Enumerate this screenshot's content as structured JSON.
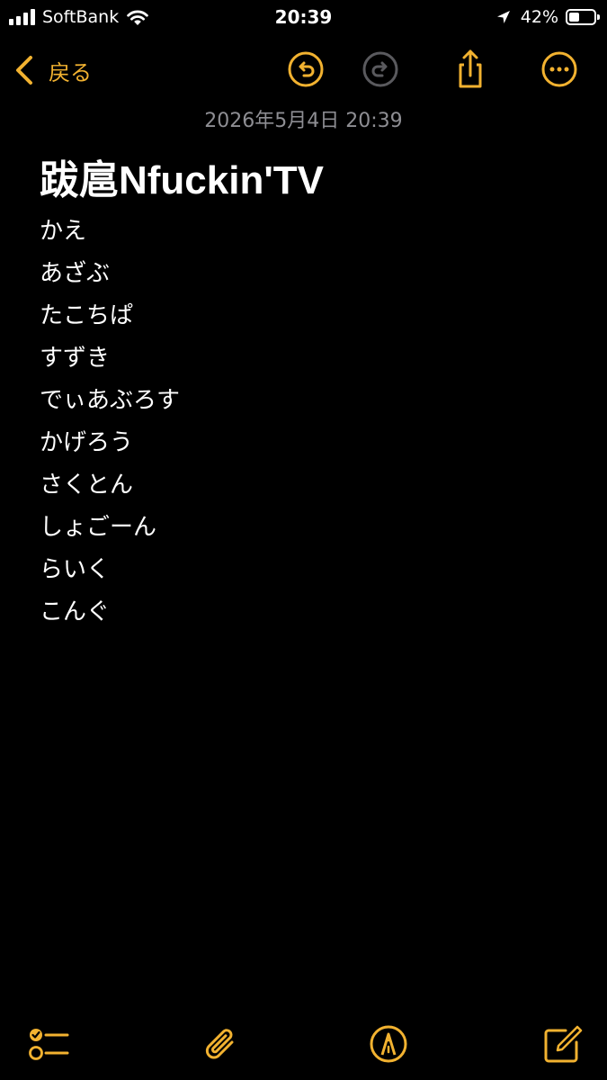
{
  "status_bar": {
    "carrier": "SoftBank",
    "time": "20:39",
    "battery_percent": "42%",
    "battery_level": 0.42,
    "signal_icon": "cellular-signal-icon",
    "wifi_icon": "wifi-icon",
    "location_icon": "location-arrow-icon",
    "battery_icon": "battery-icon"
  },
  "nav": {
    "back_label": "戻る",
    "back_icon": "chevron-left-icon",
    "undo_icon": "undo-icon",
    "redo_icon": "redo-icon",
    "share_icon": "share-icon",
    "more_icon": "more-ellipsis-icon"
  },
  "note": {
    "timestamp": "2026年5月4日 20:39",
    "title": "跋扈Nfuckin'TV",
    "lines": [
      "かえ",
      "あざぶ",
      "たこちぱ",
      "すずき",
      "でぃあぶろす",
      "かげろう",
      "さくとん",
      "しょごーん",
      "らいく",
      "こんぐ"
    ]
  },
  "toolbar": {
    "checklist_icon": "checklist-icon",
    "attachment_icon": "paperclip-icon",
    "markup_icon": "markup-pen-icon",
    "compose_icon": "compose-icon"
  },
  "colors": {
    "accent": "#f2b230",
    "background": "#000000",
    "secondary_text": "#8e8e93",
    "disabled": "#5a5a5e"
  }
}
